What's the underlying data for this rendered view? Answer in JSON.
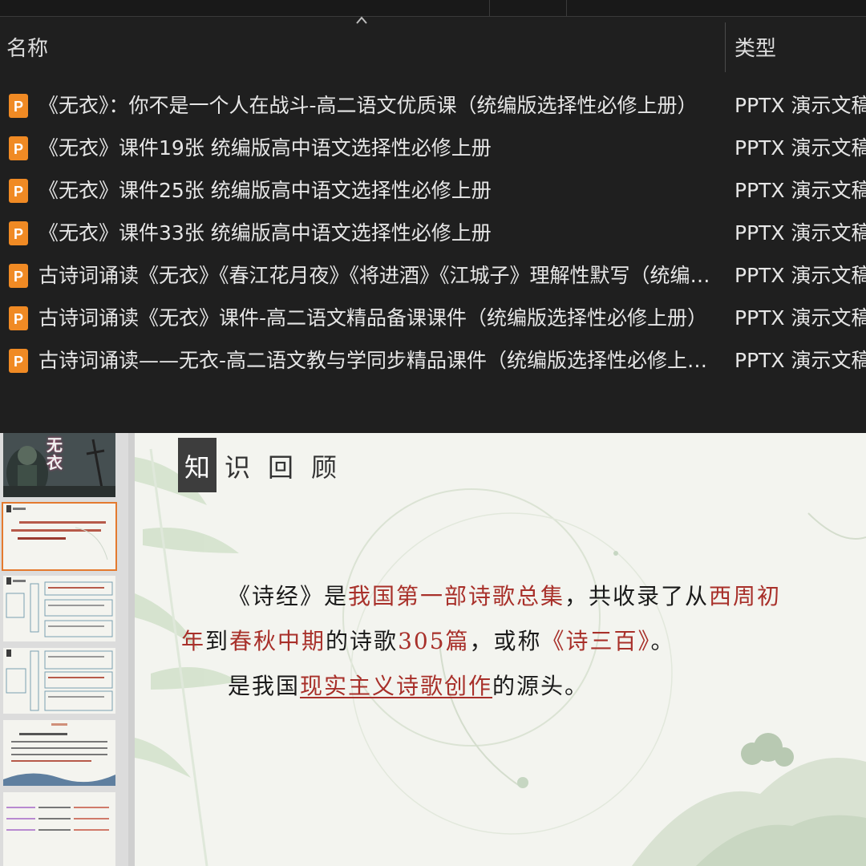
{
  "file_list": {
    "columns": {
      "name": "名称",
      "type": "类型"
    },
    "rows": [
      {
        "name": "《无衣》：你不是一个人在战斗-高二语文优质课（统编版选择性必修上册）",
        "type": "PPTX 演示文稿"
      },
      {
        "name": "《无衣》课件19张 统编版高中语文选择性必修上册",
        "type": "PPTX 演示文稿"
      },
      {
        "name": "《无衣》课件25张 统编版高中语文选择性必修上册",
        "type": "PPTX 演示文稿"
      },
      {
        "name": "《无衣》课件33张 统编版高中语文选择性必修上册",
        "type": "PPTX 演示文稿"
      },
      {
        "name": "古诗词诵读《无衣》《春江花月夜》《将进酒》《江城子》理解性默写（统编版选...",
        "type": "PPTX 演示文稿"
      },
      {
        "name": "古诗词诵读《无衣》课件-高二语文精品备课课件（统编版选择性必修上册）",
        "type": "PPTX 演示文稿"
      },
      {
        "name": "古诗词诵读——无衣-高二语文教与学同步精品课件（统编版选择性必修上册）",
        "type": "PPTX 演示文稿"
      }
    ],
    "icon": "pptx-file-icon",
    "icon_color": "#f08a24"
  },
  "thumbnails": {
    "title_slide_text": "无衣",
    "selected_index": 1,
    "accent": "#e47a2e"
  },
  "slide": {
    "heading_first": "知",
    "heading_rest": "识回顾",
    "line1": {
      "p1": "《诗经》是",
      "p2": "我国第一部诗歌总集",
      "p3": "，共收录了从",
      "p4": "西周初"
    },
    "line2": {
      "p1": "年",
      "p2": "到",
      "p3": "春秋中期",
      "p4": "的诗歌",
      "p5": "305篇",
      "p6": "，或称",
      "p7": "《诗三百》",
      "p8": "。"
    },
    "line3": {
      "p1": "是我国",
      "p2": "现实主义诗歌创作",
      "p3": "的源头。"
    },
    "colors": {
      "highlight": "#a8302a",
      "heading_box": "#3d3d3d"
    }
  }
}
